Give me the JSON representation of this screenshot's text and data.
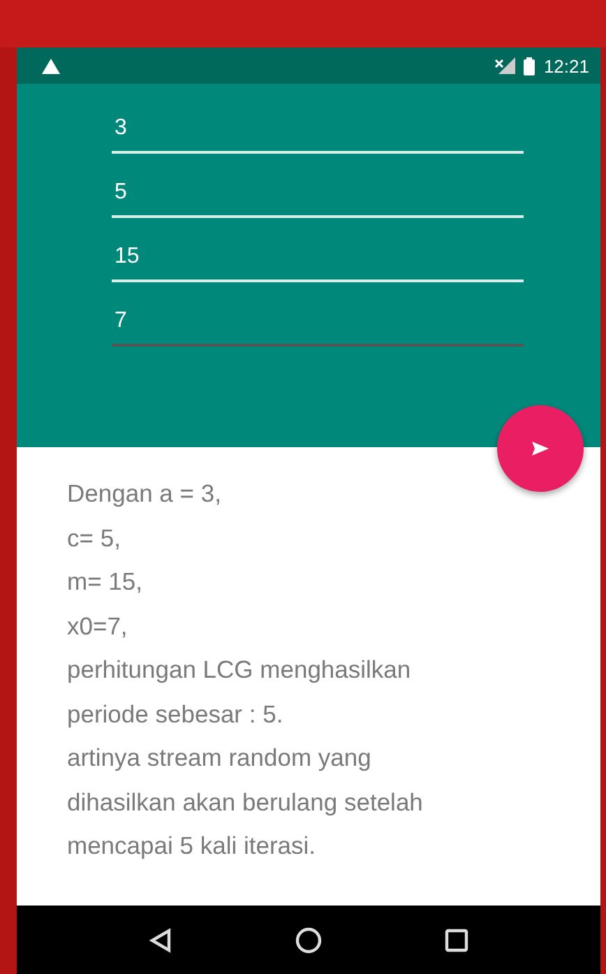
{
  "status_bar": {
    "time": "12:21"
  },
  "inputs": [
    {
      "value": "3"
    },
    {
      "value": "5"
    },
    {
      "value": "15"
    },
    {
      "value": "7",
      "focused": true
    }
  ],
  "result_lines": [
    "Dengan a = 3,",
    "c= 5,",
    "m= 15,",
    "x0=7,",
    "perhitungan LCG menghasilkan",
    "periode sebesar : 5.",
    "artinya stream random yang",
    "dihasilkan akan berulang setelah",
    "mencapai 5 kali iterasi."
  ]
}
